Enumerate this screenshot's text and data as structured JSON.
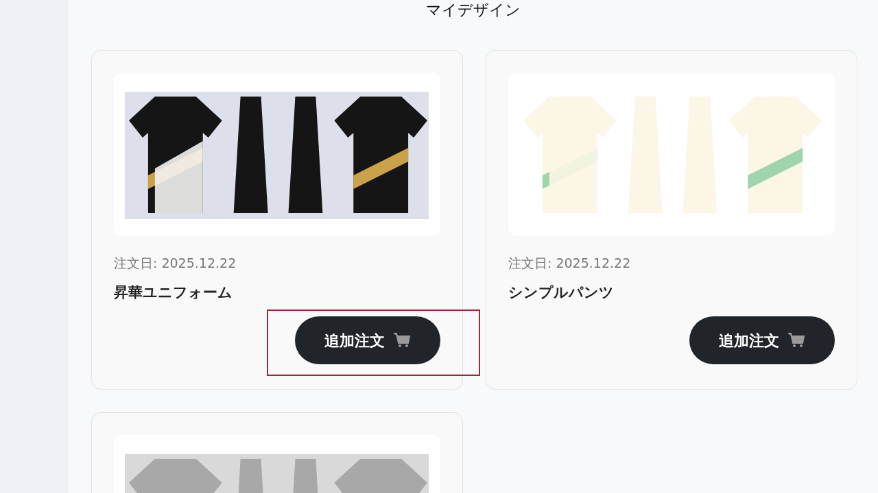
{
  "heading": "マイデザイン",
  "designs": [
    {
      "image": {
        "kind": "picture"
      },
      "order_date": "注文日: 2025.12.22",
      "name": "昇華ユニフォーム",
      "button": {
        "label": "追加注文",
        "highlighted": true
      }
    },
    {
      "image": {
        "kind": "picture"
      },
      "order_date": "注文日: 2025.12.22",
      "name": "シンプルパンツ",
      "button": {
        "label": "追加注文",
        "highlighted": false
      }
    },
    {
      "image": {
        "kind": "picture"
      }
    }
  ]
}
